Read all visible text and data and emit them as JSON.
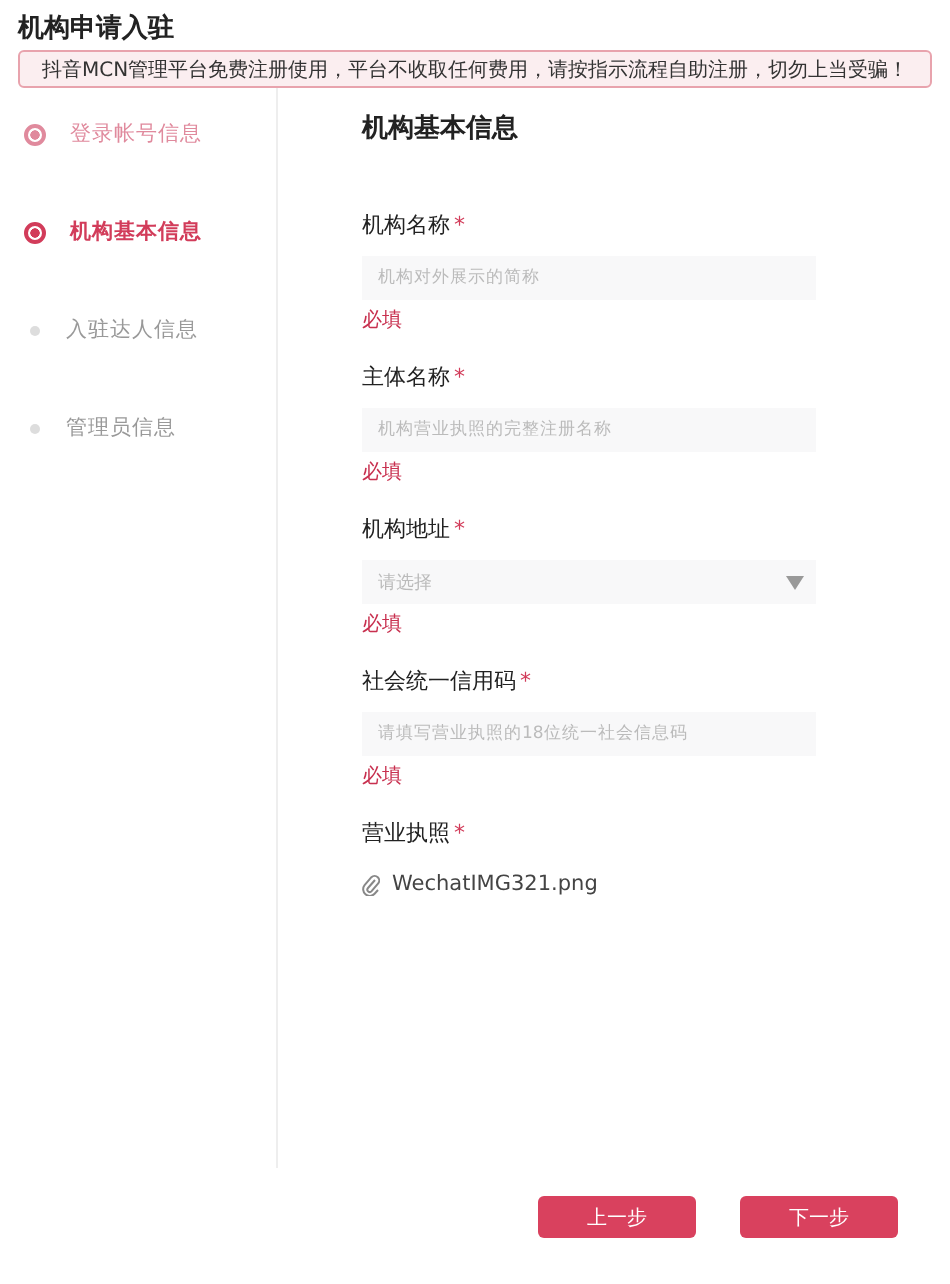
{
  "title": "机构申请入驻",
  "notice": "抖音MCN管理平台免费注册使用，平台不收取任何费用，请按指示流程自助注册，切勿上当受骗！",
  "steps": [
    {
      "label": "登录帐号信息",
      "completed": true,
      "selected": false
    },
    {
      "label": "机构基本信息",
      "completed": false,
      "selected": true
    },
    {
      "label": "入驻达人信息",
      "completed": false,
      "selected": false
    },
    {
      "label": "管理员信息",
      "completed": false,
      "selected": false
    }
  ],
  "section_title": "机构基本信息",
  "fields": [
    {
      "kind": "input",
      "label": "机构名称",
      "required_mark": "*",
      "placeholder": "机构对外展示的简称",
      "error": "必填"
    },
    {
      "kind": "input",
      "label": "主体名称",
      "required_mark": "*",
      "placeholder": "机构营业执照的完整注册名称",
      "error": "必填"
    },
    {
      "kind": "select",
      "label": "机构地址",
      "required_mark": "*",
      "placeholder": "请选择",
      "error": "必填"
    },
    {
      "kind": "input",
      "label": "社会统一信用码",
      "required_mark": "*",
      "placeholder": "请填写营业执照的18位统一社会信息码",
      "error": "必填"
    },
    {
      "kind": "file",
      "label": "营业执照",
      "required_mark": "*",
      "file": "WechatIMG321.png"
    }
  ],
  "buttons": [
    {
      "label": "上一步"
    },
    {
      "label": "下一步"
    }
  ]
}
